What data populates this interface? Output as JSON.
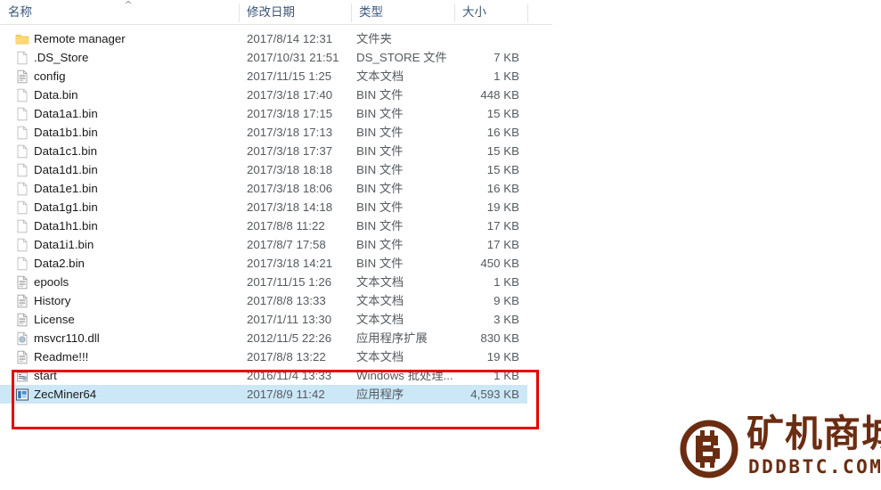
{
  "columns": {
    "name": "名称",
    "date": "修改日期",
    "type": "类型",
    "size": "大小",
    "sort_indicator": "^"
  },
  "files": [
    {
      "icon": "folder-icon",
      "name": "Remote manager",
      "date": "2017/8/14 12:31",
      "type": "文件夹",
      "size": "",
      "selected": false
    },
    {
      "icon": "blank-file-icon",
      "name": ".DS_Store",
      "date": "2017/10/31 21:51",
      "type": "DS_STORE 文件",
      "size": "7 KB",
      "selected": false
    },
    {
      "icon": "text-file-icon",
      "name": "config",
      "date": "2017/11/15 1:25",
      "type": "文本文档",
      "size": "1 KB",
      "selected": false
    },
    {
      "icon": "blank-file-icon",
      "name": "Data.bin",
      "date": "2017/3/18 17:40",
      "type": "BIN 文件",
      "size": "448 KB",
      "selected": false
    },
    {
      "icon": "blank-file-icon",
      "name": "Data1a1.bin",
      "date": "2017/3/18 17:15",
      "type": "BIN 文件",
      "size": "15 KB",
      "selected": false
    },
    {
      "icon": "blank-file-icon",
      "name": "Data1b1.bin",
      "date": "2017/3/18 17:13",
      "type": "BIN 文件",
      "size": "16 KB",
      "selected": false
    },
    {
      "icon": "blank-file-icon",
      "name": "Data1c1.bin",
      "date": "2017/3/18 17:37",
      "type": "BIN 文件",
      "size": "15 KB",
      "selected": false
    },
    {
      "icon": "blank-file-icon",
      "name": "Data1d1.bin",
      "date": "2017/3/18 18:18",
      "type": "BIN 文件",
      "size": "15 KB",
      "selected": false
    },
    {
      "icon": "blank-file-icon",
      "name": "Data1e1.bin",
      "date": "2017/3/18 18:06",
      "type": "BIN 文件",
      "size": "16 KB",
      "selected": false
    },
    {
      "icon": "blank-file-icon",
      "name": "Data1g1.bin",
      "date": "2017/3/18 14:18",
      "type": "BIN 文件",
      "size": "19 KB",
      "selected": false
    },
    {
      "icon": "blank-file-icon",
      "name": "Data1h1.bin",
      "date": "2017/8/8 11:22",
      "type": "BIN 文件",
      "size": "17 KB",
      "selected": false
    },
    {
      "icon": "blank-file-icon",
      "name": "Data1i1.bin",
      "date": "2017/8/7 17:58",
      "type": "BIN 文件",
      "size": "17 KB",
      "selected": false
    },
    {
      "icon": "blank-file-icon",
      "name": "Data2.bin",
      "date": "2017/3/18 14:21",
      "type": "BIN 文件",
      "size": "450 KB",
      "selected": false
    },
    {
      "icon": "text-file-icon",
      "name": "epools",
      "date": "2017/11/15 1:26",
      "type": "文本文档",
      "size": "1 KB",
      "selected": false
    },
    {
      "icon": "text-file-icon",
      "name": "History",
      "date": "2017/8/8 13:33",
      "type": "文本文档",
      "size": "9 KB",
      "selected": false
    },
    {
      "icon": "text-file-icon",
      "name": "License",
      "date": "2017/1/11 13:30",
      "type": "文本文档",
      "size": "3 KB",
      "selected": false
    },
    {
      "icon": "dll-file-icon",
      "name": "msvcr110.dll",
      "date": "2012/11/5 22:26",
      "type": "应用程序扩展",
      "size": "830 KB",
      "selected": false
    },
    {
      "icon": "text-file-icon",
      "name": "Readme!!!",
      "date": "2017/8/8 13:22",
      "type": "文本文档",
      "size": "19 KB",
      "selected": false
    },
    {
      "icon": "batch-file-icon",
      "name": "start",
      "date": "2016/11/4 13:33",
      "type": "Windows 批处理...",
      "size": "1 KB",
      "selected": false
    },
    {
      "icon": "application-icon",
      "name": "ZecMiner64",
      "date": "2017/8/9 11:42",
      "type": "应用程序",
      "size": "4,593 KB",
      "selected": true
    }
  ],
  "annotation": {
    "highlight_color": "#e60000"
  },
  "watermark": {
    "logo_icon": "bitcoin-logo-icon",
    "chinese_text": "矿机商城",
    "domain_text": "DDDBTC.COM",
    "color": "#6b2d12"
  }
}
